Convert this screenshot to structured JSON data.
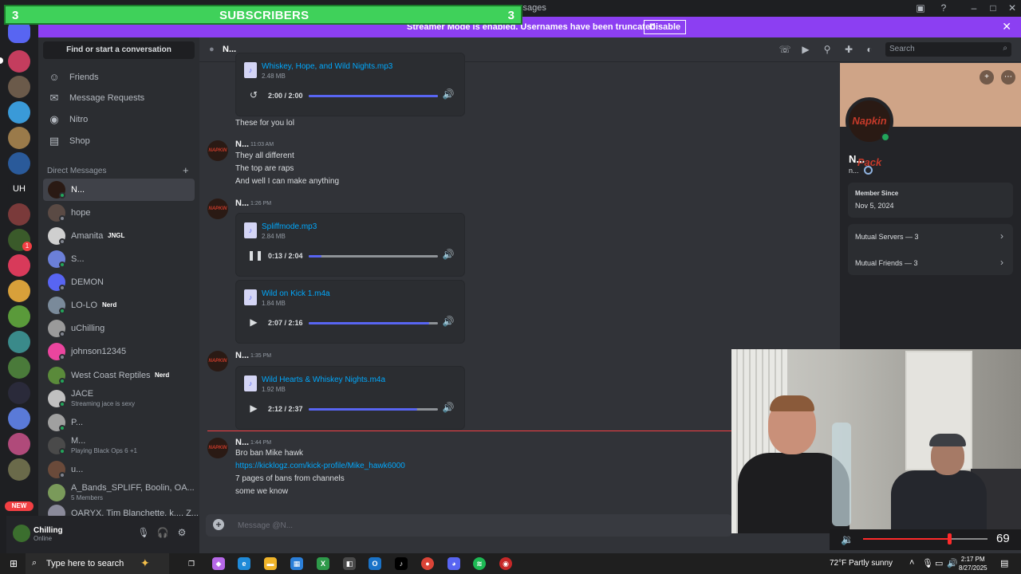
{
  "window": {
    "title_fragment": "ssages"
  },
  "overlay": {
    "left_count": "3",
    "label": "SUBSCRIBERS",
    "right_count": "3"
  },
  "banner": {
    "message": "Streamer Mode is enabled. Usernames have been truncated.",
    "button": "Disable"
  },
  "server_rail": {
    "uh_label": "UH",
    "new_label": "NEW",
    "badge": "1"
  },
  "sidebar": {
    "find_placeholder": "Find or start a conversation",
    "nav": [
      {
        "label": "Friends",
        "icon": "friends-icon"
      },
      {
        "label": "Message Requests",
        "icon": "envelope-icon"
      },
      {
        "label": "Nitro",
        "icon": "nitro-icon"
      },
      {
        "label": "Shop",
        "icon": "shop-icon"
      }
    ],
    "dm_header": "Direct Messages",
    "dms": [
      {
        "name": "N...",
        "status": "online",
        "active": true,
        "color": "#2a1a14"
      },
      {
        "name": "hope",
        "status": "offline",
        "color": "#5a4a44"
      },
      {
        "name": "Amanita",
        "tag": "JNGL",
        "status": "offline",
        "color": "#cfcfcf"
      },
      {
        "name": "S...",
        "status": "online",
        "color": "#6b7fd8"
      },
      {
        "name": "DEMON",
        "status": "offline",
        "color": "#5865f2"
      },
      {
        "name": "LO-LO",
        "tag": "Nerd",
        "status": "online",
        "color": "#7a8a9a"
      },
      {
        "name": "uChilling",
        "status": "offline",
        "color": "#9a9a9a"
      },
      {
        "name": "johnson12345",
        "status": "offline",
        "color": "#eb459e"
      },
      {
        "name": "West Coast Reptiles",
        "tag": "Nerd",
        "status": "online",
        "color": "#5a8a3a"
      },
      {
        "name": "JACE",
        "sub": "Streaming jace is sexy",
        "status": "online",
        "color": "#c0c0c0"
      },
      {
        "name": "P...",
        "status": "online",
        "color": "#a0a0a0"
      },
      {
        "name": "M...",
        "sub": "Playing Black Ops 6 +1",
        "status": "online",
        "color": "#4a4a4a"
      },
      {
        "name": "u...",
        "status": "offline",
        "color": "#6a4a3a"
      },
      {
        "name": "A_Bands_SPLIFF, Boolin, OA...",
        "sub": "5 Members",
        "status": "group",
        "color": "#7a9a5a"
      },
      {
        "name": "OARYX, Tim Blanchette, k..., Z...",
        "status": "group",
        "color": "#8a8a9a"
      }
    ]
  },
  "user_panel": {
    "name": "Chilling",
    "status": "Online"
  },
  "chat": {
    "header_name": "N...",
    "search_placeholder": "Search",
    "messages": {
      "att1": {
        "name": "Whiskey, Hope, and Wild Nights.mp3",
        "size": "2.48 MB",
        "time": "2:00 / 2:00",
        "progress": 1.0
      },
      "line_a": "These for you lol",
      "m1": {
        "author": "N...",
        "time": "11:03 AM",
        "lines": [
          "They all different",
          "The top are raps",
          "And well I can make anything"
        ]
      },
      "m2": {
        "author": "N...",
        "time": "1:26 PM"
      },
      "att2": {
        "name": "Spliffmode.mp3",
        "size": "2.84 MB",
        "time": "0:13 / 2:04",
        "progress": 0.1
      },
      "att3": {
        "name": "Wild on Kick 1.m4a",
        "size": "1.84 MB",
        "time": "2:07 / 2:16",
        "progress": 0.93
      },
      "m3": {
        "author": "N...",
        "time": "1:35 PM"
      },
      "att4": {
        "name": "Wild Hearts & Whiskey Nights.m4a",
        "size": "1.92 MB",
        "time": "2:12 / 2:37",
        "progress": 0.84
      },
      "m4": {
        "author": "N...",
        "time": "1:44 PM",
        "line1": "Bro ban Mike hawk",
        "link": "https://kicklogz.com/kick-profile/Mike_hawk6000",
        "line2": "7 pages of bans from channels",
        "line3": "some we know"
      }
    },
    "composer_placeholder": "Message @N..."
  },
  "profile": {
    "name": "N...",
    "username": "n...",
    "member_since_label": "Member Since",
    "member_since": "Nov 5, 2024",
    "mutual_servers": "Mutual Servers — 3",
    "mutual_friends": "Mutual Friends — 3",
    "avatar_text": "Napkin Pack"
  },
  "volume": {
    "value": "69",
    "level": 0.69
  },
  "taskbar": {
    "search_placeholder": "Type here to search",
    "weather": "72°F  Partly sunny",
    "time": "2:17 PM",
    "date": "8/27/2025"
  }
}
